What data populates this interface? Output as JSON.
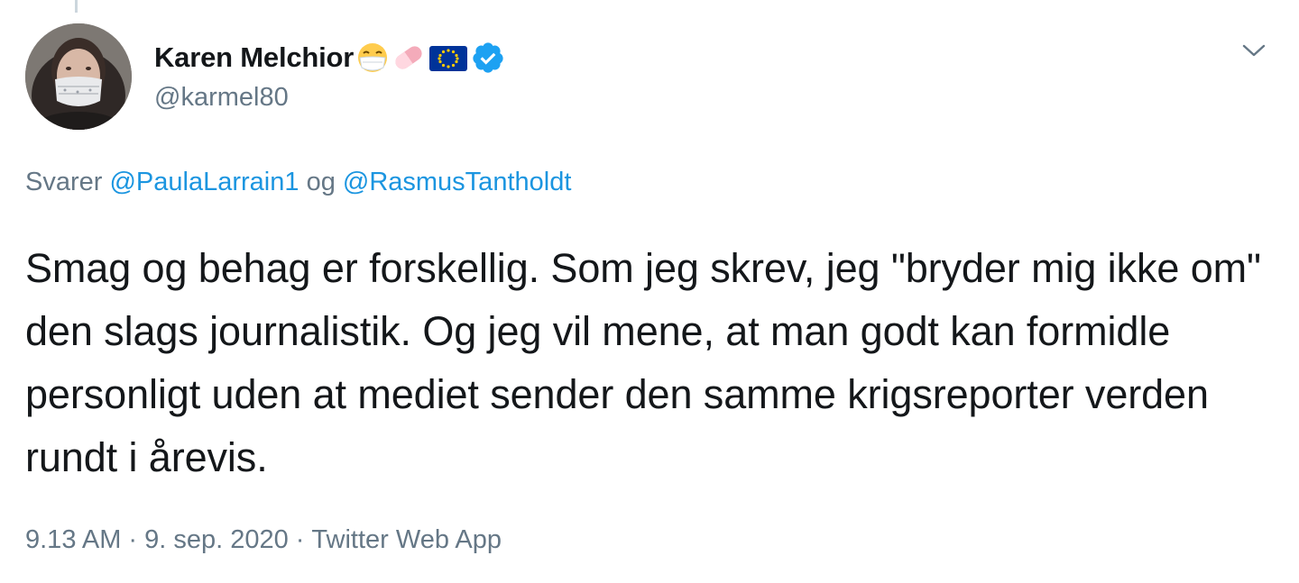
{
  "tweet": {
    "author": {
      "display_name": "Karen Melchior",
      "handle": "@karmel80",
      "badges": [
        "mask-face-emoji",
        "pill-emoji",
        "eu-flag-emoji",
        "verified-icon"
      ]
    },
    "reply": {
      "prefix": "Svarer",
      "mention_1": "@PaulaLarrain1",
      "joiner": "og",
      "mention_2": "@RasmusTantholdt"
    },
    "text": "Smag og behag er forskellig. Som jeg skrev, jeg \"bryder mig ikke om\" den slags journalistik. Og jeg vil mene, at man godt kan formidle personligt uden at mediet sender den samme krigsreporter verden rundt i årevis.",
    "meta": {
      "time": "9.13 AM",
      "date": "9. sep. 2020",
      "source": "Twitter Web App",
      "separator": "·"
    },
    "menu_icon": "chevron-down-icon"
  },
  "colors": {
    "text_primary": "#14171a",
    "text_secondary": "#657786",
    "link": "#1b95e0",
    "verified": "#1da1f2"
  }
}
